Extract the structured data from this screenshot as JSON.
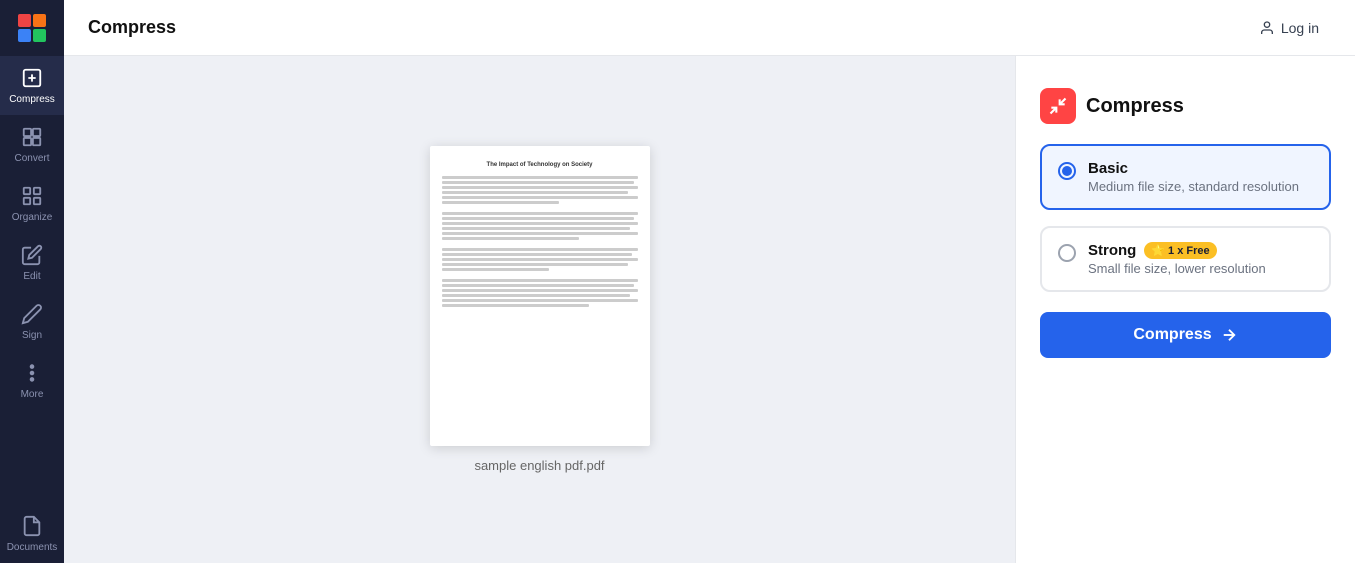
{
  "topbar": {
    "title": "Compress",
    "login_label": "Log in"
  },
  "sidebar": {
    "items": [
      {
        "id": "compress",
        "label": "Compress",
        "active": true
      },
      {
        "id": "convert",
        "label": "Convert",
        "active": false
      },
      {
        "id": "organize",
        "label": "Organize",
        "active": false
      },
      {
        "id": "edit",
        "label": "Edit",
        "active": false
      },
      {
        "id": "sign",
        "label": "Sign",
        "active": false
      },
      {
        "id": "more",
        "label": "More",
        "active": false
      },
      {
        "id": "documents",
        "label": "Documents",
        "active": false
      }
    ]
  },
  "preview": {
    "filename": "sample english pdf.pdf",
    "title": "The Impact of Technology on Society"
  },
  "panel": {
    "title": "Compress",
    "options": [
      {
        "id": "basic",
        "label": "Basic",
        "description": "Medium file size, standard resolution",
        "selected": true,
        "badge": null
      },
      {
        "id": "strong",
        "label": "Strong",
        "description": "Small file size, lower resolution",
        "selected": false,
        "badge": "1 x Free"
      }
    ],
    "compress_button": "Compress"
  }
}
